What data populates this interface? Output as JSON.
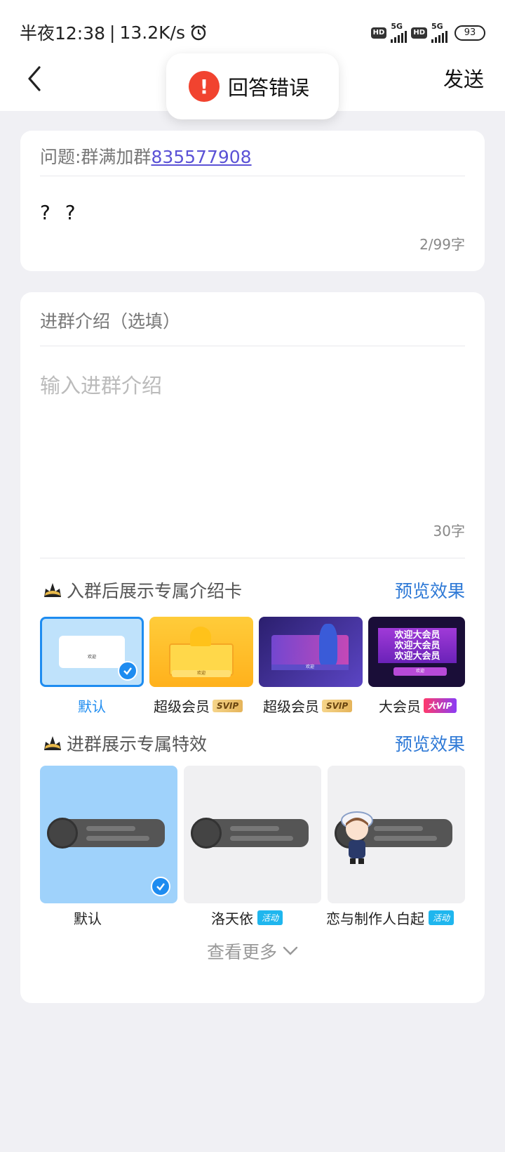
{
  "status_bar": {
    "time": "半夜12:38",
    "speed": "13.2K/s",
    "network1": "5G",
    "network2": "5G",
    "hd_label": "HD",
    "battery": "93"
  },
  "header": {
    "send_label": "发送"
  },
  "toast": {
    "message": "回答错误"
  },
  "question_card": {
    "question_prefix": "问题:群满加群",
    "question_number": "835577908",
    "answer": "? ?",
    "char_count": "2/99字"
  },
  "intro_card": {
    "label": "进群介绍（选填）",
    "placeholder": "输入进群介绍",
    "char_count": "30字"
  },
  "intro_cards_section": {
    "title": "入群后展示专属介绍卡",
    "preview_label": "预览效果",
    "items": [
      {
        "label": "默认",
        "badge": "",
        "selected": true
      },
      {
        "label": "超级会员",
        "badge": "SVIP",
        "selected": false
      },
      {
        "label": "超级会员",
        "badge": "SVIP",
        "selected": false
      },
      {
        "label": "大会员",
        "badge": "大VIP",
        "selected": false
      }
    ],
    "thumb_texts": {
      "welcome": "欢迎",
      "welcome_big_1": "欢迎大会员",
      "welcome_big_2": "欢迎大会员",
      "welcome_big_3": "欢迎大会员"
    }
  },
  "effects_section": {
    "title": "进群展示专属特效",
    "preview_label": "预览效果",
    "items": [
      {
        "label": "默认",
        "badge": "",
        "selected": true
      },
      {
        "label": "洛天依",
        "badge": "活动",
        "selected": false
      },
      {
        "label": "恋与制作人白起",
        "badge": "活动",
        "selected": false
      }
    ],
    "more_label": "查看更多"
  },
  "colors": {
    "accent_blue": "#2e79d6",
    "check_blue": "#1e8cf0",
    "error_red": "#f1432f",
    "link_purple": "#5b52d6"
  }
}
